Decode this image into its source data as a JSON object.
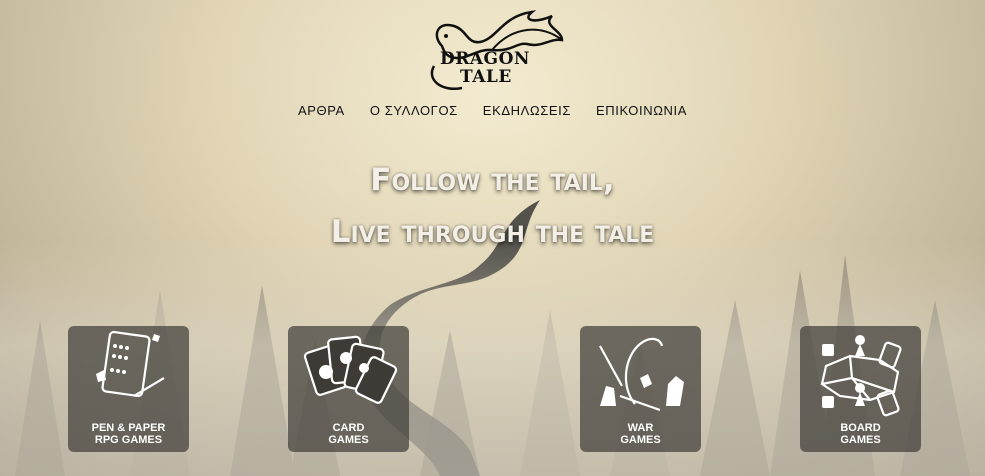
{
  "brand": {
    "line1": "DRAGON",
    "line2": "TALE"
  },
  "nav": [
    {
      "label": "ΑΡΘΡΑ"
    },
    {
      "label": "Ο ΣΥΛΛΟΓΟΣ"
    },
    {
      "label": "ΕΚΔΗΛΩΣΕΙΣ"
    },
    {
      "label": "ΕΠΙΚΟΙΝΩΝΙΑ"
    }
  ],
  "hero": {
    "line1": "Follow the tail,",
    "line2": "Live through the tale"
  },
  "categories": [
    {
      "line1": "PEN & PAPER",
      "line2": "RPG GAMES",
      "icon": "character-sheet-icon"
    },
    {
      "line1": "CARD",
      "line2": "GAMES",
      "icon": "playing-cards-icon"
    },
    {
      "line1": "WAR",
      "line2": "GAMES",
      "icon": "miniatures-icon"
    },
    {
      "line1": "BOARD",
      "line2": "GAMES",
      "icon": "board-game-icon"
    }
  ]
}
